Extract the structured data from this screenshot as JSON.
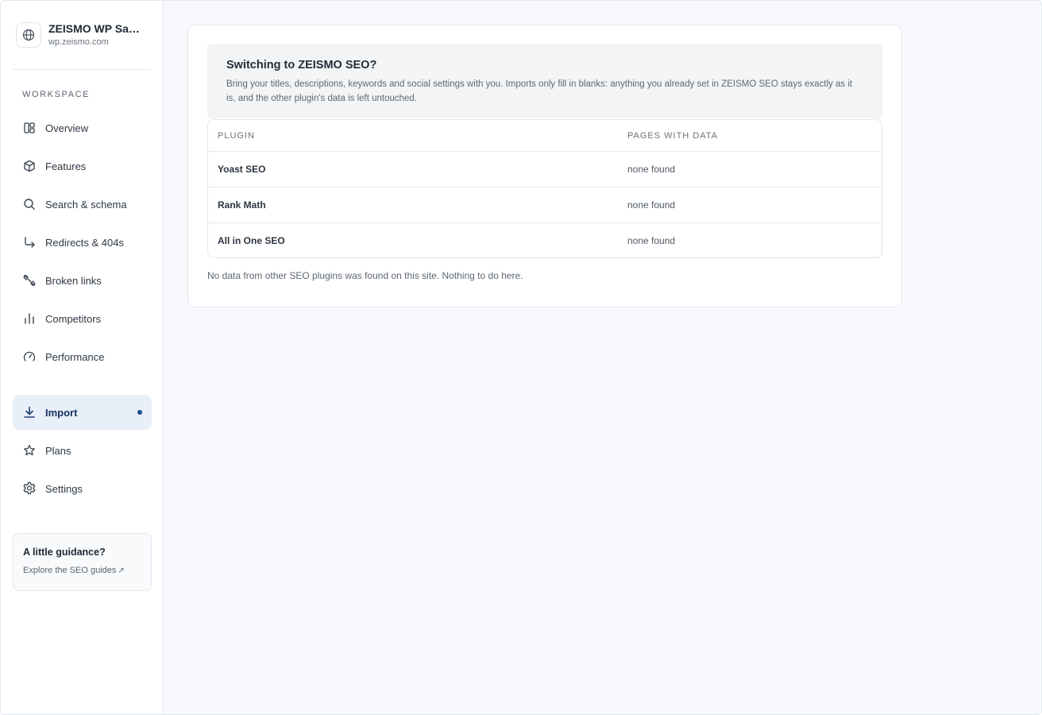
{
  "sidebar": {
    "site_name": "ZEISMO WP Sand...",
    "site_url": "wp.zeismo.com",
    "section_label": "WORKSPACE",
    "items": [
      {
        "label": "Overview",
        "icon": "layout-icon"
      },
      {
        "label": "Features",
        "icon": "box-icon"
      },
      {
        "label": "Search & schema",
        "icon": "search-icon"
      },
      {
        "label": "Redirects & 404s",
        "icon": "redirect-arrow-icon"
      },
      {
        "label": "Broken links",
        "icon": "broken-link-icon"
      },
      {
        "label": "Competitors",
        "icon": "bar-chart-icon"
      },
      {
        "label": "Performance",
        "icon": "gauge-icon"
      },
      {
        "label": "Import",
        "icon": "download-icon",
        "active": true
      },
      {
        "label": "Plans",
        "icon": "star-icon"
      },
      {
        "label": "Settings",
        "icon": "gear-icon"
      }
    ],
    "guide": {
      "title": "A little guidance?",
      "link": "Explore the SEO guides"
    }
  },
  "main": {
    "banner": {
      "title": "Switching to ZEISMO SEO?",
      "text": "Bring your titles, descriptions, keywords and social settings with you. Imports only fill in blanks: anything you already set in ZEISMO SEO stays exactly as it is, and the other plugin's data is left untouched."
    },
    "table": {
      "headers": [
        "PLUGIN",
        "PAGES WITH DATA"
      ],
      "rows": [
        {
          "plugin": "Yoast SEO",
          "pages": "none found"
        },
        {
          "plugin": "Rank Math",
          "pages": "none found"
        },
        {
          "plugin": "All in One SEO",
          "pages": "none found"
        }
      ]
    },
    "note": "No data from other SEO plugins was found on this site. Nothing to do here."
  },
  "colors": {
    "accent": "#1c4e94",
    "active_bg": "#e9eff9",
    "page_bg": "#f7f9fd"
  }
}
